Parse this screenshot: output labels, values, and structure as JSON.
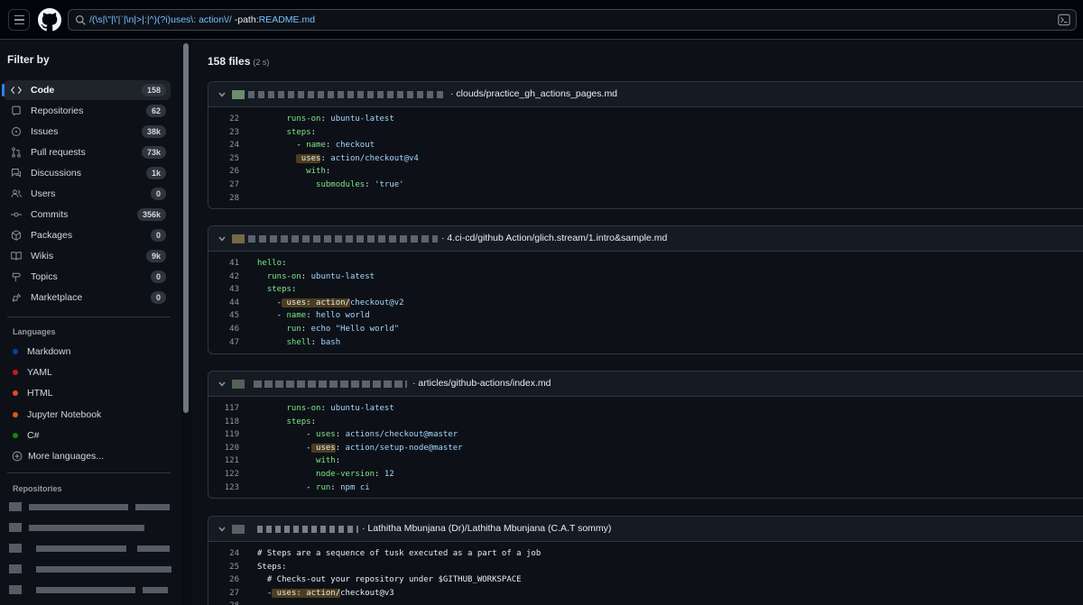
{
  "header": {
    "search_query_prefix": "/(\\s|\\\"|\\'|`|\\n|>|:|^)(?i)uses\\: action\\//",
    "search_qualifier": " -path:",
    "search_qualifier_value": "README.md"
  },
  "sidebar": {
    "title": "Filter by",
    "items": [
      {
        "label": "Code",
        "count": "158",
        "icon": "code-icon"
      },
      {
        "label": "Repositories",
        "count": "62",
        "icon": "repo-icon"
      },
      {
        "label": "Issues",
        "count": "38k",
        "icon": "issue-icon"
      },
      {
        "label": "Pull requests",
        "count": "73k",
        "icon": "pull-request-icon"
      },
      {
        "label": "Discussions",
        "count": "1k",
        "icon": "discussion-icon"
      },
      {
        "label": "Users",
        "count": "0",
        "icon": "users-icon"
      },
      {
        "label": "Commits",
        "count": "356k",
        "icon": "commit-icon"
      },
      {
        "label": "Packages",
        "count": "0",
        "icon": "package-icon"
      },
      {
        "label": "Wikis",
        "count": "9k",
        "icon": "book-icon"
      },
      {
        "label": "Topics",
        "count": "0",
        "icon": "topic-icon"
      },
      {
        "label": "Marketplace",
        "count": "0",
        "icon": "marketplace-icon"
      }
    ],
    "languages_title": "Languages",
    "languages": [
      {
        "label": "Markdown",
        "color": "#083fa1"
      },
      {
        "label": "YAML",
        "color": "#cb171e"
      },
      {
        "label": "HTML",
        "color": "#e34c26"
      },
      {
        "label": "Jupyter Notebook",
        "color": "#da5b0b"
      },
      {
        "label": "C#",
        "color": "#178600"
      }
    ],
    "more_languages": "More languages...",
    "repositories_title": "Repositories"
  },
  "results": {
    "count_label": "158 files",
    "time_label": "(2 s)",
    "cards": [
      {
        "path": "· clouds/practice_gh_actions_pages.md",
        "lines": [
          {
            "n": "22",
            "segments": [
              [
                "k",
                "      runs-on"
              ],
              [
                "c",
                ": "
              ],
              [
                "s",
                "ubuntu-latest"
              ]
            ]
          },
          {
            "n": "23",
            "segments": [
              [
                "k",
                "      steps"
              ],
              [
                "c",
                ":"
              ]
            ]
          },
          {
            "n": "24",
            "segments": [
              [
                "c",
                "        - "
              ],
              [
                "k",
                "name"
              ],
              [
                "c",
                ": "
              ],
              [
                "s",
                "checkout"
              ]
            ]
          },
          {
            "n": "25",
            "segments": [
              [
                "c",
                "        "
              ],
              [
                "hl",
                " uses"
              ],
              [
                "c",
                ": "
              ],
              [
                "s",
                "action/checkout@v4"
              ]
            ]
          },
          {
            "n": "26",
            "segments": [
              [
                "k",
                "          with"
              ],
              [
                "c",
                ":"
              ]
            ]
          },
          {
            "n": "27",
            "segments": [
              [
                "k",
                "            submodules"
              ],
              [
                "c",
                ": "
              ],
              [
                "s",
                "'true'"
              ]
            ]
          },
          {
            "n": "28",
            "segments": [
              [
                "c",
                ""
              ]
            ]
          }
        ]
      },
      {
        "path": "· 4.ci-cd/github Action/glich.stream/1.intro&sample.md",
        "lines": [
          {
            "n": "41",
            "segments": [
              [
                "k",
                "hello"
              ],
              [
                "c",
                ":"
              ]
            ]
          },
          {
            "n": "42",
            "segments": [
              [
                "k",
                "  runs-on"
              ],
              [
                "c",
                ": "
              ],
              [
                "s",
                "ubuntu-latest"
              ]
            ]
          },
          {
            "n": "43",
            "segments": [
              [
                "k",
                "  steps"
              ],
              [
                "c",
                ":"
              ]
            ]
          },
          {
            "n": "44",
            "segments": [
              [
                "c",
                "    -"
              ],
              [
                "hl",
                " uses: action/"
              ],
              [
                "s",
                "checkout@v2"
              ]
            ]
          },
          {
            "n": "45",
            "segments": [
              [
                "c",
                "    - "
              ],
              [
                "k",
                "name"
              ],
              [
                "c",
                ": "
              ],
              [
                "s",
                "hello world"
              ]
            ]
          },
          {
            "n": "46",
            "segments": [
              [
                "k",
                "      run"
              ],
              [
                "c",
                ": "
              ],
              [
                "s",
                "echo \"Hello world\""
              ]
            ]
          },
          {
            "n": "47",
            "segments": [
              [
                "k",
                "      shell"
              ],
              [
                "c",
                ": "
              ],
              [
                "s",
                "bash"
              ]
            ]
          }
        ]
      },
      {
        "path": "· articles/github-actions/index.md",
        "lines": [
          {
            "n": "117",
            "segments": [
              [
                "k",
                "      runs-on"
              ],
              [
                "c",
                ": "
              ],
              [
                "s",
                "ubuntu-latest"
              ]
            ]
          },
          {
            "n": "118",
            "segments": [
              [
                "k",
                "      steps"
              ],
              [
                "c",
                ":"
              ]
            ]
          },
          {
            "n": "119",
            "segments": [
              [
                "c",
                "          - "
              ],
              [
                "k",
                "uses"
              ],
              [
                "c",
                ": "
              ],
              [
                "s",
                "actions/checkout@master"
              ]
            ]
          },
          {
            "n": "120",
            "segments": [
              [
                "c",
                "          -"
              ],
              [
                "hl",
                " uses"
              ],
              [
                "c",
                ": "
              ],
              [
                "s",
                "action/setup-node@master"
              ]
            ]
          },
          {
            "n": "121",
            "segments": [
              [
                "k",
                "            with"
              ],
              [
                "c",
                ":"
              ]
            ]
          },
          {
            "n": "122",
            "segments": [
              [
                "k",
                "            node-version"
              ],
              [
                "c",
                ": "
              ],
              [
                "s",
                "12"
              ]
            ]
          },
          {
            "n": "123",
            "segments": [
              [
                "c",
                "          - "
              ],
              [
                "k",
                "run"
              ],
              [
                "c",
                ": "
              ],
              [
                "s",
                "npm ci"
              ]
            ]
          }
        ]
      },
      {
        "path": "· Lathitha Mbunjana (Dr)/Lathitha Mbunjana (C.A.T sommy)",
        "lines": [
          {
            "n": "24",
            "segments": [
              [
                "c",
                "# Steps are a sequence of tusk executed as a part of a job"
              ]
            ]
          },
          {
            "n": "25",
            "segments": [
              [
                "c",
                "Steps:"
              ]
            ]
          },
          {
            "n": "26",
            "segments": [
              [
                "c",
                "  # Checks-out your repository under $GITHUB_WORKSPACE"
              ]
            ]
          },
          {
            "n": "27",
            "segments": [
              [
                "c",
                "  -"
              ],
              [
                "hl",
                " uses: action/"
              ],
              [
                "c",
                "checkout@v3"
              ]
            ]
          },
          {
            "n": "28",
            "segments": [
              [
                "c",
                ""
              ]
            ]
          }
        ]
      }
    ]
  }
}
